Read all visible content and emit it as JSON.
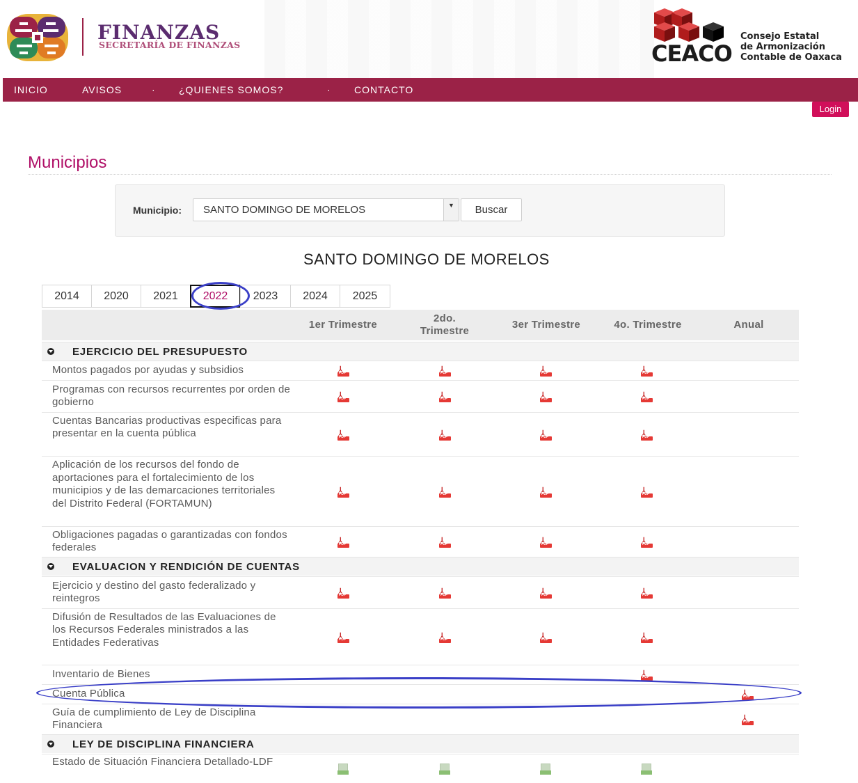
{
  "header": {
    "finanzas_title": "FINANZAS",
    "finanzas_subtitle": "SECRETARÍA DE FINANZAS",
    "ceaco_name": "CEACO",
    "ceaco_desc_1": "Consejo Estatal",
    "ceaco_desc_2": "de Armonización",
    "ceaco_desc_3": "Contable de Oaxaca"
  },
  "nav": {
    "items": [
      "INICIO",
      "AVISOS",
      "·",
      "¿QUIENES SOMOS?",
      "·",
      "CONTACTO"
    ],
    "login": "Login"
  },
  "page": {
    "title": "Municipios",
    "search_label": "Municipio:",
    "search_value": "SANTO DOMINGO DE MORELOS",
    "search_button": "Buscar",
    "municipality_heading": "SANTO DOMINGO DE MORELOS"
  },
  "years": [
    "2014",
    "2020",
    "2021",
    "2022",
    "2023",
    "2024",
    "2025"
  ],
  "active_year": "2022",
  "columns": [
    "1er Trimestre",
    "2do. Trimestre",
    "3er Trimestre",
    "4o. Trimestre",
    "Anual"
  ],
  "sections": [
    {
      "name": "EJERCICIO DEL PRESUPUESTO",
      "rows": [
        {
          "label": "Montos pagados por ayudas y subsidios",
          "files": [
            "pdf",
            "pdf",
            "pdf",
            "pdf",
            ""
          ]
        },
        {
          "label": "Programas con recursos recurrentes por orden de gobierno",
          "files": [
            "pdf",
            "pdf",
            "pdf",
            "pdf",
            ""
          ]
        },
        {
          "label": "Cuentas Bancarias productivas especificas para presentar en la cuenta pública",
          "files": [
            "pdf",
            "pdf",
            "pdf",
            "pdf",
            ""
          ]
        },
        {
          "label": "Aplicación de los recursos del fondo de aportaciones para el fortalecimiento de los municipios y de las demarcaciones territoriales del Distrito Federal (FORTAMUN)",
          "files": [
            "pdf",
            "pdf",
            "pdf",
            "pdf",
            ""
          ]
        },
        {
          "label": "Obligaciones pagadas o garantizadas con fondos federales",
          "files": [
            "pdf",
            "pdf",
            "pdf",
            "pdf",
            ""
          ]
        }
      ]
    },
    {
      "name": "EVALUACION Y RENDICIÓN DE CUENTAS",
      "rows": [
        {
          "label": "Ejercicio y destino del gasto federalizado y reintegros",
          "files": [
            "pdf",
            "pdf",
            "pdf",
            "pdf",
            ""
          ]
        },
        {
          "label": "Difusión de Resultados de las Evaluaciones de los Recursos Federales ministrados a las Entidades Federativas",
          "files": [
            "pdf",
            "pdf",
            "pdf",
            "pdf",
            ""
          ]
        },
        {
          "label": "Inventario de Bienes",
          "files": [
            "",
            "",
            "",
            "pdf",
            ""
          ]
        },
        {
          "label": "Cuenta Pública",
          "files": [
            "",
            "",
            "",
            "",
            "pdf"
          ]
        },
        {
          "label": "Guía de cumplimiento de Ley de Disciplina Financiera",
          "files": [
            "",
            "",
            "",
            "",
            "pdf"
          ]
        }
      ]
    },
    {
      "name": "LEY DE DISCIPLINA FINANCIERA",
      "rows": [
        {
          "label": "Estado de Situación Financiera Detallado-LDF",
          "files": [
            "xls",
            "xls",
            "xls",
            "xls",
            ""
          ]
        }
      ]
    }
  ]
}
